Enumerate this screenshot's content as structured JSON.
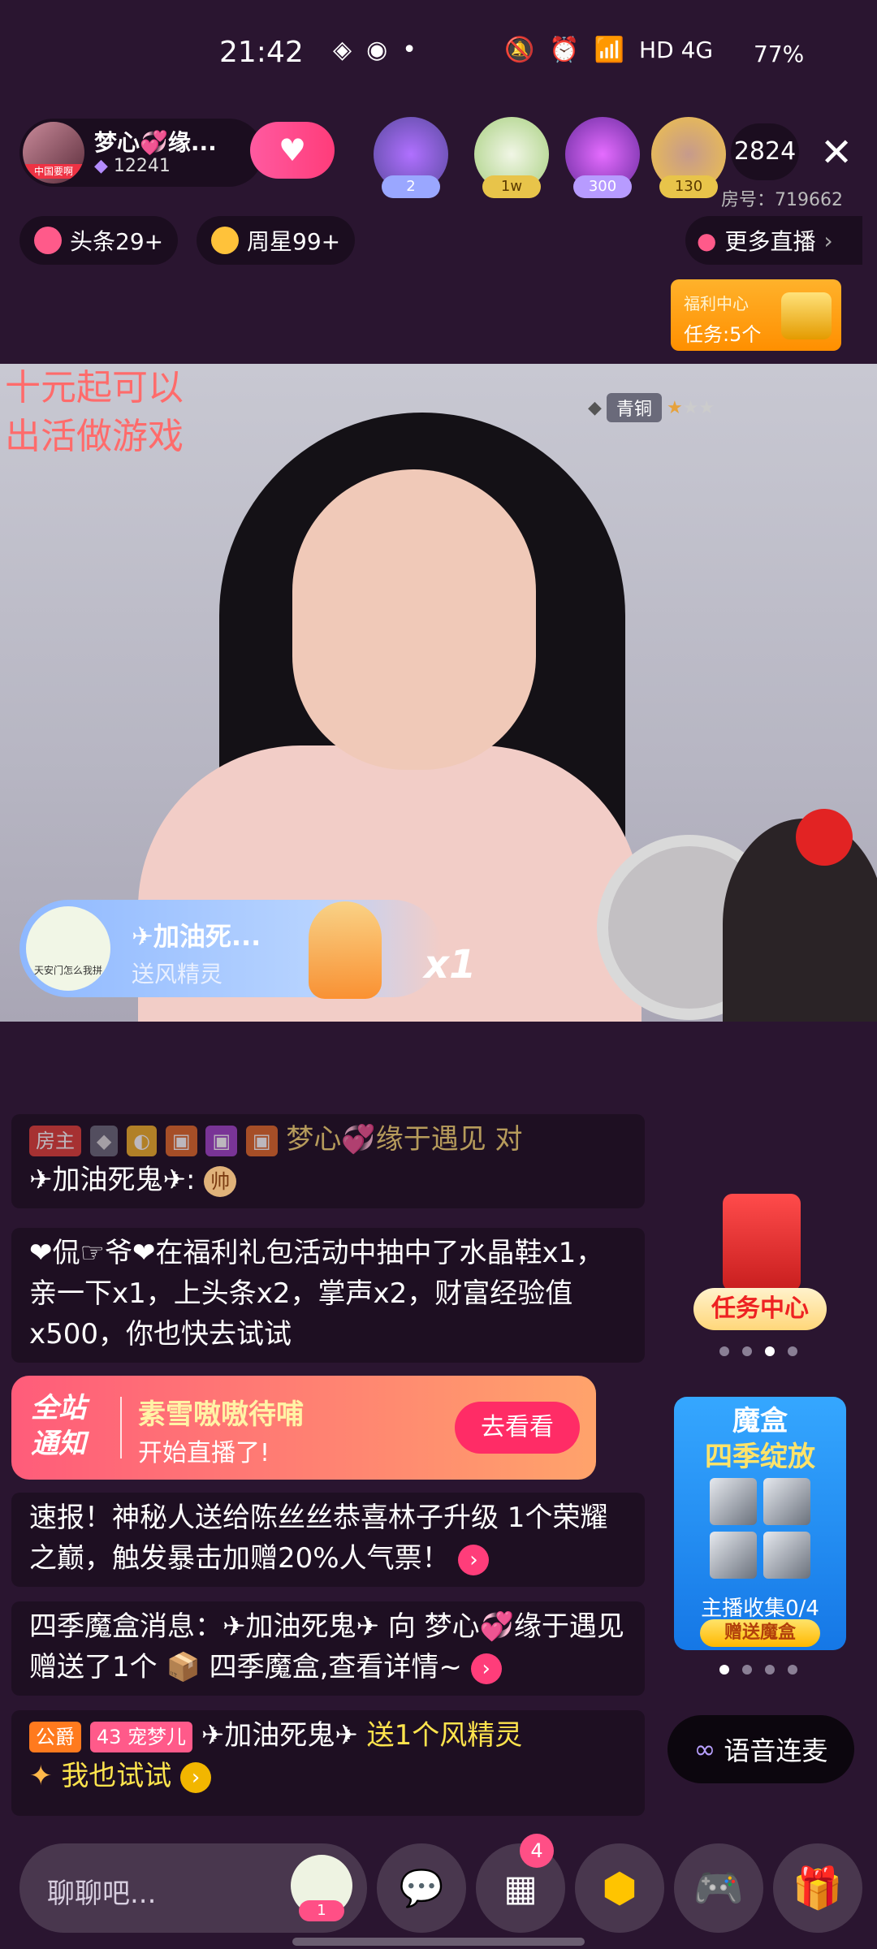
{
  "status_bar": {
    "time": "21:42",
    "network": "HD 4G",
    "battery": "77%"
  },
  "header": {
    "host_name": "梦心💞缘...",
    "host_tag": "中国要啊",
    "host_fans": "12241",
    "follow_icon": "heart-plus",
    "viewers": [
      {
        "badge": "2",
        "color": "#9aa7ff"
      },
      {
        "badge": "1w",
        "color": "#e8c44a"
      },
      {
        "badge": "300",
        "color": "#b79bff"
      },
      {
        "badge": "130",
        "color": "#e8c44a"
      }
    ],
    "viewer_count": "2824",
    "room_no": "房号：719662"
  },
  "chips": {
    "headline": "头条29+",
    "weekly_star": "周星99+",
    "more_live": "更多直播"
  },
  "welfare": {
    "title": "福利中心",
    "tasks": "任务:5个"
  },
  "video": {
    "overlay_text_1": "十元起可以",
    "overlay_text_2": "出活做游戏",
    "rank": "青铜"
  },
  "gift_banner": {
    "avatar_text": "天安门怎么我拼",
    "user": "✈加油死...",
    "desc": "送风精灵",
    "count": "x1"
  },
  "chat": {
    "msg1_medal": "房主",
    "msg1_text": "梦心💞缘于遇见 对",
    "msg1_line2": "✈加油死鬼✈:",
    "msg1_emoji": "帅",
    "msg2": "❤侃☞爷❤在福利礼包活动中抽中了水晶鞋x1，亲一下x1，上头条x2，掌声x2，财富经验值x500，你也快去试试",
    "notice_title_1": "全站",
    "notice_title_2": "通知",
    "notice_nick": "素雪嗷嗷待哺",
    "notice_sub": "开始直播了!",
    "notice_btn": "去看看",
    "msg3": "速报！神秘人送给陈丝丝恭喜林子升级 1个荣耀之巅，触发暴击加赠20%人气票！",
    "msg4": "四季魔盒消息：✈加油死鬼✈ 向 梦心💞缘于遇见 赠送了1个 📦 四季魔盒,查看详情~",
    "msg5_medal1": "公爵",
    "msg5_medal2": "43 宠梦儿",
    "msg5_user": "✈加油死鬼✈",
    "msg5_action": "送1个风精灵",
    "msg5_try": "我也试试"
  },
  "side": {
    "task_center": "任务中心",
    "magic_box_title_1": "魔盒",
    "magic_box_title_2": "四季绽放",
    "magic_box_collect": "主播收集0/4",
    "magic_box_btn": "赠送魔盒",
    "voice_link": "语音连麦"
  },
  "bottom": {
    "chat_placeholder": "聊聊吧...",
    "fan_level": "1",
    "more_badge": "4"
  }
}
